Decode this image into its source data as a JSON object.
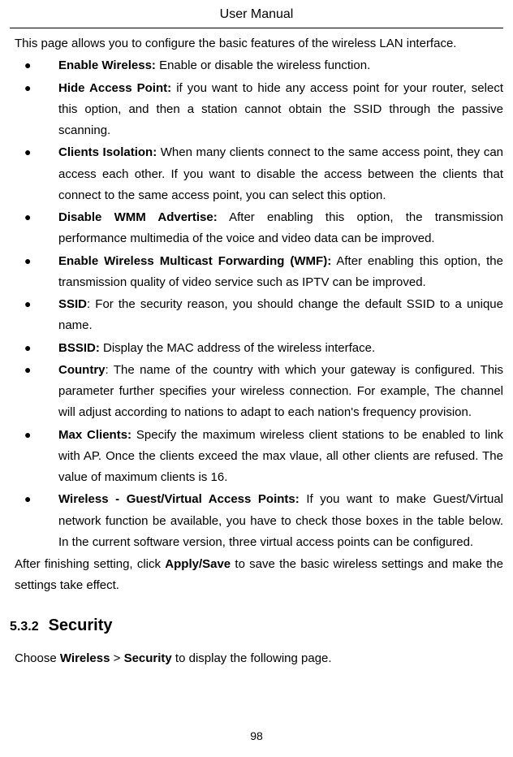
{
  "header": "User Manual",
  "intro": "This page allows you to configure the basic features of the wireless LAN interface.",
  "items": [
    {
      "term": "Enable Wireless:",
      "desc": " Enable or disable the wireless function."
    },
    {
      "term": "Hide Access Point:",
      "desc": " if you want to hide any access point for your router, select this option, and then a station cannot obtain the SSID through the passive scanning."
    },
    {
      "term": "Clients Isolation:",
      "desc": " When many clients connect to the same access point, they can access each other. If you want to disable the access between the clients that connect to the same access point, you can select this option."
    },
    {
      "term": "Disable WMM Advertise:",
      "desc": " After enabling this option, the transmission performance multimedia of the voice and video data can be improved."
    },
    {
      "term": "Enable Wireless Multicast Forwarding (WMF):",
      "desc": " After enabling this option, the transmission quality of video service such as IPTV can be improved."
    },
    {
      "term": "SSID",
      "desc": ": For the security reason, you should change the default SSID to a unique name."
    },
    {
      "term": "BSSID:",
      "desc": " Display the MAC address of the wireless interface."
    },
    {
      "term": "Country",
      "desc": ": The name of the country with which your gateway is configured. This parameter further specifies your wireless connection. For example, The channel will adjust according to nations to adapt to each nation's frequency provision."
    },
    {
      "term": "Max Clients:",
      "desc": " Specify the maximum wireless client stations to be enabled to link with AP. Once the clients exceed the max vlaue, all other clients are refused. The value of maximum clients is 16."
    },
    {
      "term": "Wireless - Guest/Virtual Access Points:",
      "desc": " If you want to make Guest/Virtual network function be available, you have to check those boxes in the table below. In the current software version, three virtual access points can be configured."
    }
  ],
  "closing_pre": "After finishing setting, click ",
  "closing_bold": "Apply/Save",
  "closing_post": " to save the basic wireless settings and make the settings take effect.",
  "section": {
    "num": "5.3.2",
    "title": "Security"
  },
  "section_body_pre": "Choose ",
  "section_body_b1": "Wireless",
  "section_body_mid": " > ",
  "section_body_b2": "Security",
  "section_body_post": " to display the following page.",
  "page_number": "98"
}
